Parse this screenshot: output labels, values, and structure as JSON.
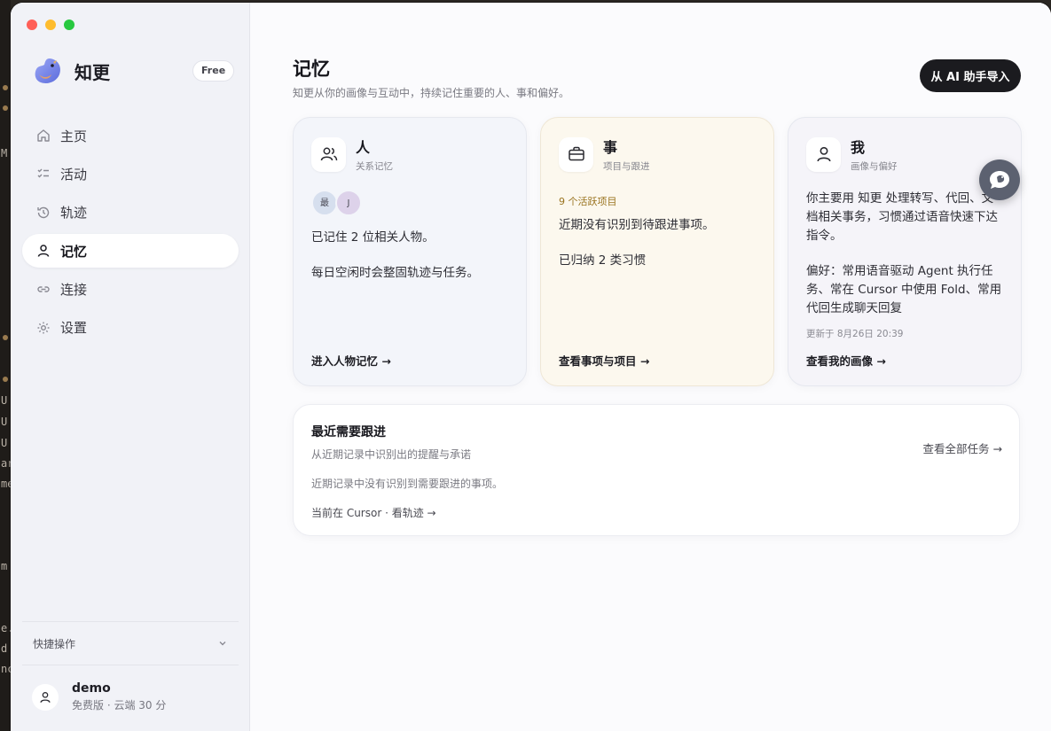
{
  "background": {
    "fragments": [
      "M",
      "U",
      "U",
      "U",
      "ar",
      "me",
      "m",
      "e.",
      "d",
      "nc"
    ]
  },
  "window": {
    "accent": "#1b1b1f",
    "traffic_lights": [
      "#ff5f57",
      "#febc2e",
      "#28c840"
    ]
  },
  "sidebar": {
    "brand_name": "知更",
    "plan": "Free",
    "nav": [
      {
        "label": "主页",
        "icon": "home-icon"
      },
      {
        "label": "活动",
        "icon": "checklist-icon"
      },
      {
        "label": "轨迹",
        "icon": "history-icon"
      },
      {
        "label": "记忆",
        "icon": "person-icon",
        "active": true
      },
      {
        "label": "连接",
        "icon": "link-icon"
      },
      {
        "label": "设置",
        "icon": "gear-icon"
      }
    ],
    "quick_actions": "快捷操作",
    "user": {
      "name": "demo",
      "subtitle": "免费版 · 云端 30 分"
    }
  },
  "main": {
    "title": "记忆",
    "subtitle": "知更从你的画像与互动中，持续记住重要的人、事和偏好。",
    "import_button": "从 AI 助手导入",
    "cards": {
      "people": {
        "title": "人",
        "subtitle": "关系记忆",
        "avatars": [
          "最",
          "J"
        ],
        "lines": [
          "已记住 2 位相关人物。",
          "每日空闲时会整固轨迹与任务。"
        ],
        "link": "进入人物记忆 →"
      },
      "things": {
        "title": "事",
        "subtitle": "项目与跟进",
        "meta": "9 个活跃项目",
        "lines": [
          "近期没有识别到待跟进事项。",
          "已归纳 2 类习惯"
        ],
        "link": "查看事项与项目 →"
      },
      "me": {
        "title": "我",
        "subtitle": "画像与偏好",
        "lines": [
          "你主要用 知更 处理转写、代回、文档相关事务，习惯通过语音快速下达指令。",
          "偏好：常用语音驱动 Agent 执行任务、常在 Cursor 中使用 Fold、常用代回生成聊天回复"
        ],
        "updated": "更新于 8月26日 20:39",
        "link": "查看我的画像 →"
      }
    },
    "follow_up": {
      "title": "最近需要跟进",
      "subtitle": "从近期记录中识别出的提醒与承诺",
      "empty": "近期记录中没有识别到需要跟进的事项。",
      "context_link": "当前在 Cursor · 看轨迹 →",
      "all_link": "查看全部任务 →"
    }
  }
}
